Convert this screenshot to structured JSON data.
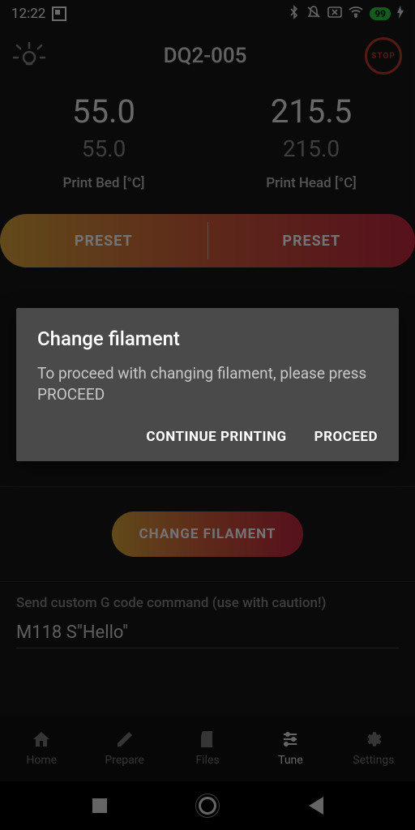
{
  "status": {
    "time": "12:22",
    "battery": "99"
  },
  "header": {
    "title": "DQ2-005",
    "stop_label": "STOP"
  },
  "temps": {
    "bed_actual": "55.0",
    "bed_target": "55.0",
    "bed_label": "Print Bed [°C]",
    "head_actual": "215.5",
    "head_target": "215.0",
    "head_label": "Print Head [°C]"
  },
  "presets": {
    "left": "PRESET",
    "right": "PRESET"
  },
  "change_filament_btn": "CHANGE FILAMENT",
  "gcode": {
    "label": "Send custom G code command (use with caution!)",
    "value": "M118 S\"Hello\""
  },
  "dialog": {
    "title": "Change filament",
    "body": "To proceed with changing filament, please press PROCEED",
    "continue": "CONTINUE PRINTING",
    "proceed": "PROCEED"
  },
  "nav": {
    "home": "Home",
    "prepare": "Prepare",
    "files": "Files",
    "tune": "Tune",
    "settings": "Settings"
  }
}
